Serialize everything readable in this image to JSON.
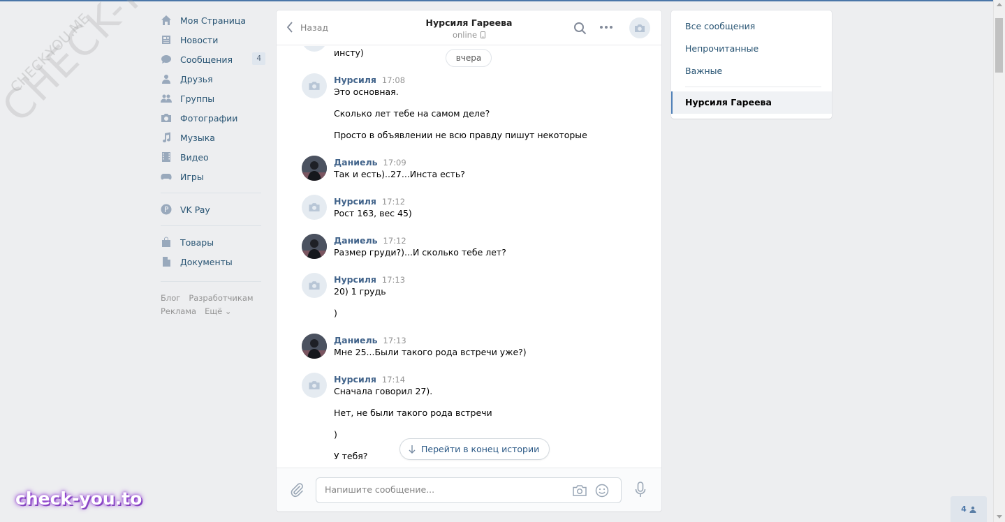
{
  "watermark": {
    "big": "CHECK-YOU.ME",
    "small": "CHECK-YOU.ME",
    "brand": "check-you.to"
  },
  "nav": {
    "items": [
      {
        "label": "Моя Страница",
        "icon": "home-icon"
      },
      {
        "label": "Новости",
        "icon": "news-icon"
      },
      {
        "label": "Сообщения",
        "icon": "messages-icon",
        "badge": "4"
      },
      {
        "label": "Друзья",
        "icon": "friends-icon"
      },
      {
        "label": "Группы",
        "icon": "groups-icon"
      },
      {
        "label": "Фотографии",
        "icon": "photos-icon"
      },
      {
        "label": "Музыка",
        "icon": "music-icon"
      },
      {
        "label": "Видео",
        "icon": "video-icon"
      },
      {
        "label": "Игры",
        "icon": "games-icon"
      },
      {
        "label": "VK Pay",
        "icon": "vkpay-icon"
      },
      {
        "label": "Товары",
        "icon": "market-icon"
      },
      {
        "label": "Документы",
        "icon": "docs-icon"
      }
    ],
    "footer": [
      "Блог",
      "Разработчикам",
      "Реклама",
      "Ещё ⌄"
    ]
  },
  "header": {
    "back_label": "Назад",
    "peer_name": "Нурсиля Гареева",
    "peer_status": "online"
  },
  "history": {
    "day_label": "вчера",
    "top_fragment": "инсту)",
    "messages": [
      {
        "author": "Нурсиля",
        "time": "17:08",
        "lines": [
          "Это основная.",
          "Сколько лет тебе на самом деле?",
          "Просто в объявлении не всю правду пишут некоторые"
        ]
      },
      {
        "author": "Даниель",
        "time": "17:09",
        "lines": [
          "Так и есть)..27...Инста есть?"
        ]
      },
      {
        "author": "Нурсиля",
        "time": "17:12",
        "lines": [
          "Рост 163, вес 45)"
        ]
      },
      {
        "author": "Даниель",
        "time": "17:12",
        "lines": [
          "Размер груди?)...И сколько тебе лет?"
        ]
      },
      {
        "author": "Нурсиля",
        "time": "17:13",
        "lines": [
          "20) 1 грудь",
          ")"
        ]
      },
      {
        "author": "Даниель",
        "time": "17:13",
        "lines": [
          "Мне 25...Были такого рода встречи уже?)"
        ]
      },
      {
        "author": "Нурсиля",
        "time": "17:14",
        "lines": [
          "Сначала говорил 27).",
          "Нет, не были такого рода встречи",
          ")",
          "У тебя?"
        ]
      }
    ],
    "to_end_label": "Перейти в конец истории"
  },
  "compose": {
    "placeholder": "Напишите сообщение..."
  },
  "right_panel": {
    "items": [
      "Все сообщения",
      "Непрочитанные",
      "Важные"
    ],
    "active_dialog": "Нурсиля Гареева"
  },
  "online_count": "4",
  "colors": {
    "accent": "#4a76a8",
    "link": "#2a5885",
    "background": "#edeef0"
  }
}
